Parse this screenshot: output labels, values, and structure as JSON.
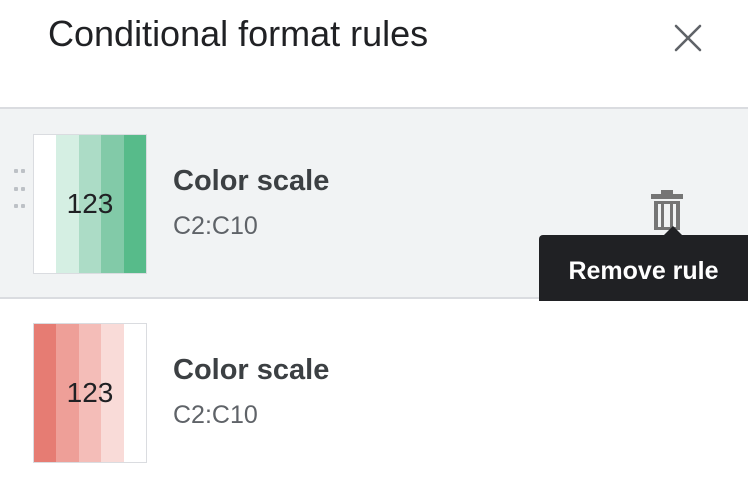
{
  "header": {
    "title": "Conditional format rules",
    "close_icon": "close-icon"
  },
  "rules": [
    {
      "name": "Color scale",
      "range": "C2:C10",
      "preview_text": "123",
      "colors": [
        "#ffffff",
        "#d5efe3",
        "#acdcc6",
        "#82caa8",
        "#57bb8a"
      ]
    },
    {
      "name": "Color scale",
      "range": "C2:C10",
      "preview_text": "123",
      "colors": [
        "#e67c73",
        "#ee9f98",
        "#f4bdb8",
        "#f9dbd8",
        "#ffffff"
      ]
    }
  ],
  "actions": {
    "delete_icon": "trash-icon",
    "tooltip": "Remove rule"
  }
}
